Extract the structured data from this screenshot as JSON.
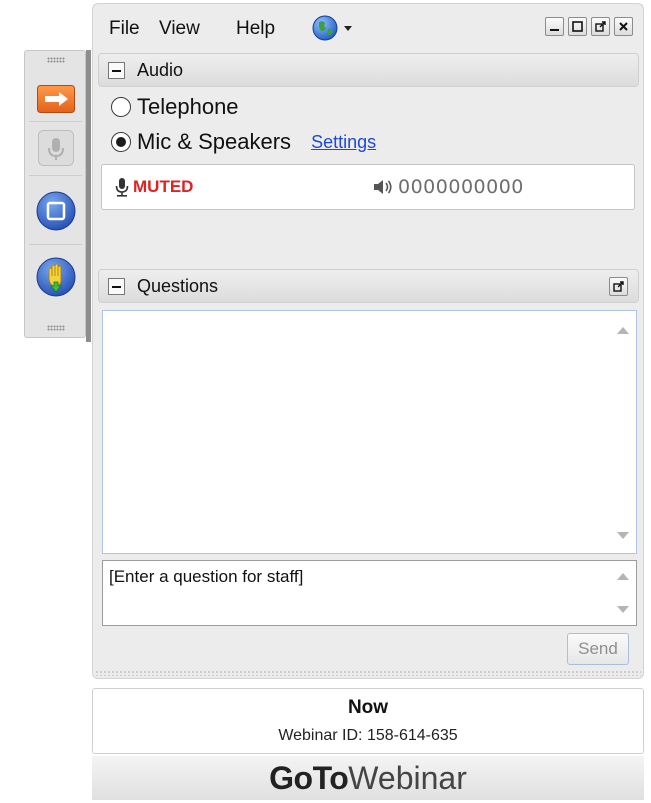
{
  "menubar": {
    "file": "File",
    "view": "View",
    "help": "Help",
    "language_icon": "globe-icon"
  },
  "window_controls": [
    "minimize-icon",
    "maximize-icon",
    "restore-icon",
    "close-icon"
  ],
  "audio": {
    "header": "Audio",
    "options": [
      {
        "label": "Telephone",
        "selected": false
      },
      {
        "label": "Mic & Speakers",
        "selected": true
      }
    ],
    "settings_link": "Settings",
    "status": "MUTED",
    "speaker_level": "0000000000"
  },
  "questions": {
    "header": "Questions",
    "input_text": "[Enter a question for staff]",
    "send_label": "Send"
  },
  "info": {
    "title": "Now",
    "webinar_id": "Webinar ID: 158-614-635"
  },
  "brand": {
    "bold": "GoTo",
    "light": "Webinar"
  },
  "control_panel": {
    "buttons": [
      "show-hide-arrow-icon",
      "microphone-icon",
      "screen-icon",
      "raise-hand-icon"
    ],
    "colors": {
      "accent_orange": "#f07a2a",
      "control_blue": "#2f5fc4",
      "muted_red": "#e02222",
      "link_blue": "#1d48d8"
    }
  }
}
